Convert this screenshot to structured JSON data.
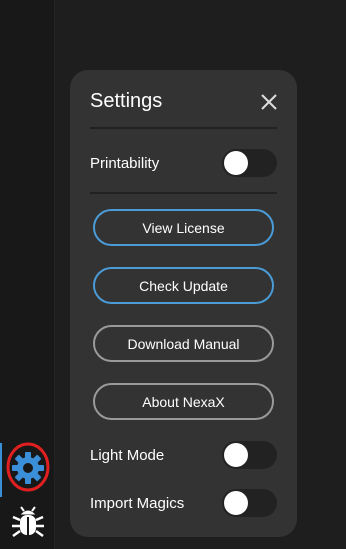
{
  "sidebar": {
    "items": [
      {
        "name": "settings",
        "icon": "gear-icon",
        "active": true,
        "color": "#3a8fd8"
      },
      {
        "name": "debug",
        "icon": "bug-icon",
        "active": false,
        "color": "#ffffff"
      }
    ],
    "annotation_color": "#e02020"
  },
  "settings_panel": {
    "title": "Settings",
    "close_icon": "close-icon",
    "printability": {
      "label": "Printability",
      "enabled": false
    },
    "buttons": {
      "view_license": "View License",
      "check_update": "Check Update",
      "download_manual": "Download Manual",
      "about": "About NexaX"
    },
    "light_mode": {
      "label": "Light Mode",
      "enabled": false
    },
    "import_magics": {
      "label": "Import Magics",
      "enabled": false
    }
  },
  "colors": {
    "accent": "#4a9bd6",
    "panel_bg": "#333333",
    "page_bg": "#1e1e1e"
  }
}
